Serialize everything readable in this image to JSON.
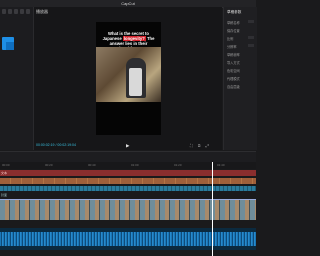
{
  "app": {
    "title": "CapCut"
  },
  "preview": {
    "header": "播放器",
    "caption_white": "What is the secret to Japanese",
    "caption_red": "longevity?",
    "caption_rest": "The answer lies in their breakfast",
    "time": "00:00:02:19 / 00:02:19:04",
    "play_icon": "▶",
    "tools": "⛶ ⊡ ⤢"
  },
  "right_panel": {
    "title": "草稿参数",
    "rows": [
      "草稿名称",
      "保存位置",
      "比例",
      "分辨率",
      "草稿帧率",
      "导入方式",
      "色彩空间",
      "代理模式",
      "自由层级"
    ]
  },
  "timeline": {
    "ruler": [
      "00:00",
      "00:20",
      "00:40",
      "01:00",
      "01:20",
      "01:40"
    ],
    "text_track_label": "文本",
    "video_track_label": "封面"
  },
  "colors": {
    "accent": "#39c0e0",
    "brand": "#1e8fe6"
  }
}
